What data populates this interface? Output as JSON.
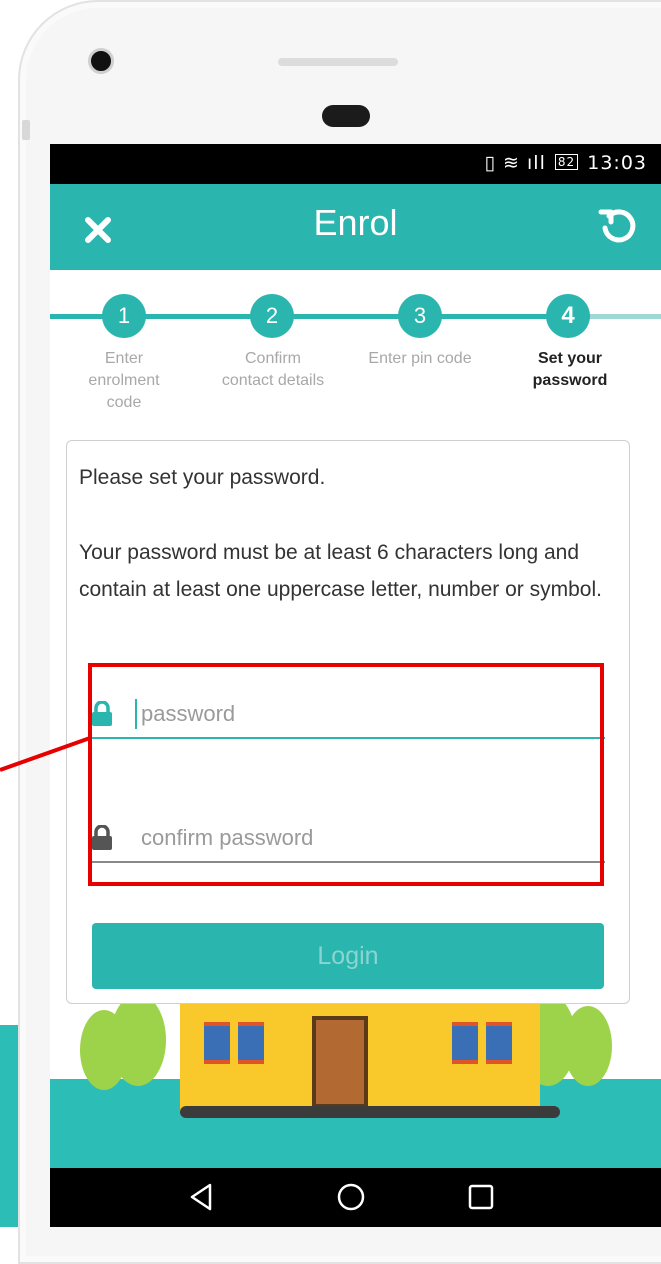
{
  "status_bar": {
    "battery": "82",
    "time": "13:03"
  },
  "app_bar": {
    "title": "Enrol"
  },
  "stepper": {
    "steps": [
      {
        "number": "1",
        "label_line1": "Enter",
        "label_line2": "enrolment",
        "label_line3": "code"
      },
      {
        "number": "2",
        "label_line1": "Confirm",
        "label_line2": "contact details"
      },
      {
        "number": "3",
        "label_line1": "Enter pin code"
      },
      {
        "number": "4",
        "label_line1": "Set your",
        "label_line2": "password"
      }
    ],
    "active_step": 4
  },
  "card": {
    "intro": "Please set your password.",
    "rules": "Your password must be at least 6 characters long and contain at least one uppercase letter, number or symbol.",
    "password_placeholder": "password",
    "confirm_placeholder": "confirm password",
    "login_label": "Login"
  },
  "colors": {
    "primary": "#2bb5af",
    "highlight": "#e60000"
  },
  "icons": {
    "close": "close-icon",
    "refresh": "refresh-icon",
    "lock": "lock-icon"
  }
}
